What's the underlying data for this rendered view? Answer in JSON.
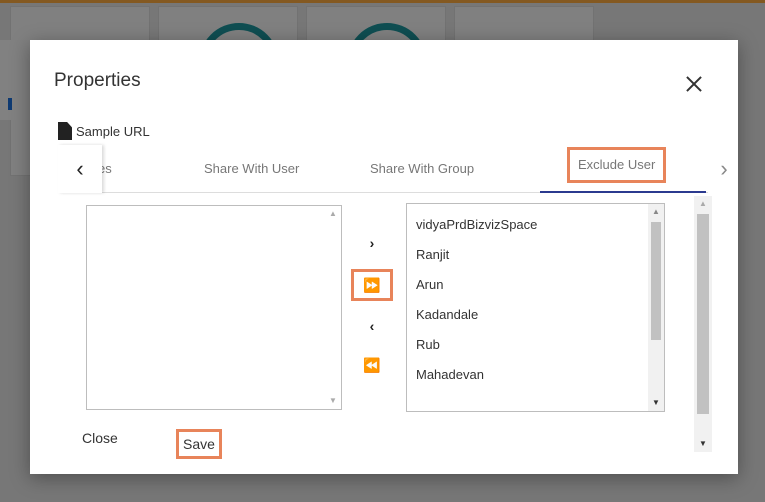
{
  "dialog": {
    "title": "Properties",
    "file_name": "Sample URL"
  },
  "tabs": [
    {
      "label": "erties"
    },
    {
      "label": "Share With User"
    },
    {
      "label": "Share With Group"
    },
    {
      "label": "Exclude User",
      "active": true
    }
  ],
  "available_list": [],
  "selected_list": [
    "vidyaPrdBizvizSpace",
    "Ranjit",
    "Arun",
    "Kadandale",
    "Rub",
    "Mahadevan"
  ],
  "transfer": {
    "move_one": "›",
    "move_all": "⏩",
    "back_one": "‹",
    "back_all": "⏪"
  },
  "footer": {
    "close_label": "Close",
    "save_label": "Save"
  },
  "icons": {
    "file": "file-icon",
    "close": "close-icon",
    "prev": "chevron-left-icon",
    "next": "chevron-right-icon"
  },
  "colors": {
    "highlight": "#e8845a",
    "tab_underline": "#2b3a8f",
    "accent_bar": "#f0a23c"
  }
}
